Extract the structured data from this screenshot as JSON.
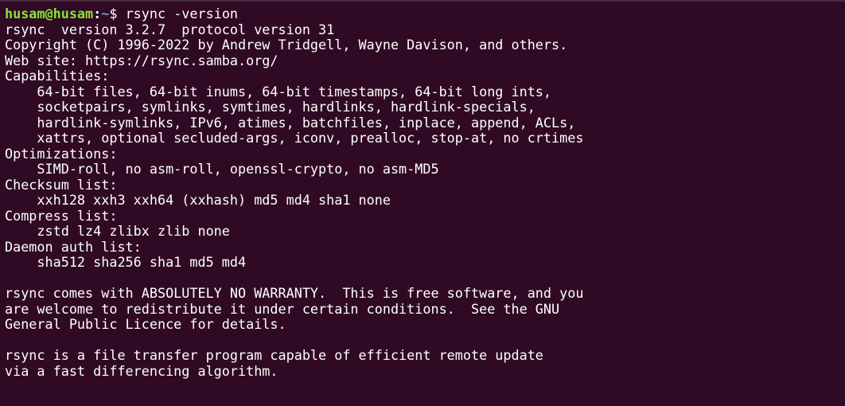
{
  "prompt": {
    "user_host": "husam@husam",
    "separator": ":",
    "path": "~",
    "symbol": "$ ",
    "command": "rsync -version"
  },
  "output": [
    "rsync  version 3.2.7  protocol version 31",
    "Copyright (C) 1996-2022 by Andrew Tridgell, Wayne Davison, and others.",
    "Web site: https://rsync.samba.org/",
    "Capabilities:",
    "    64-bit files, 64-bit inums, 64-bit timestamps, 64-bit long ints,",
    "    socketpairs, symlinks, symtimes, hardlinks, hardlink-specials,",
    "    hardlink-symlinks, IPv6, atimes, batchfiles, inplace, append, ACLs,",
    "    xattrs, optional secluded-args, iconv, prealloc, stop-at, no crtimes",
    "Optimizations:",
    "    SIMD-roll, no asm-roll, openssl-crypto, no asm-MD5",
    "Checksum list:",
    "    xxh128 xxh3 xxh64 (xxhash) md5 md4 sha1 none",
    "Compress list:",
    "    zstd lz4 zlibx zlib none",
    "Daemon auth list:",
    "    sha512 sha256 sha1 md5 md4",
    "",
    "rsync comes with ABSOLUTELY NO WARRANTY.  This is free software, and you",
    "are welcome to redistribute it under certain conditions.  See the GNU",
    "General Public Licence for details.",
    "",
    "rsync is a file transfer program capable of efficient remote update",
    "via a fast differencing algorithm."
  ],
  "colors": {
    "background": "#300a24",
    "foreground": "#ffffff",
    "prompt_user": "#8ae234",
    "prompt_path": "#729fcf"
  }
}
